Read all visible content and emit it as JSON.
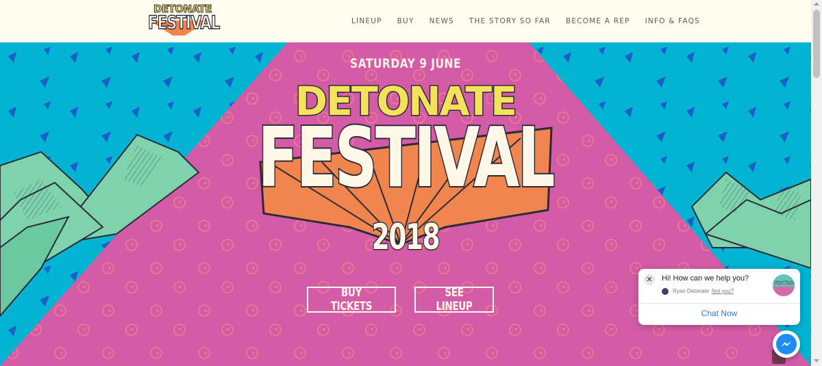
{
  "header": {
    "logo_top": "DETONATE",
    "logo_main": "FESTIVAL",
    "nav": [
      "LINEUP",
      "BUY",
      "NEWS",
      "THE STORY SO FAR",
      "BECOME A REP",
      "INFO & FAQS"
    ]
  },
  "hero": {
    "date": "SATURDAY 9 JUNE",
    "title_top": "DETONATE",
    "title_main": "FESTIVAL",
    "year": "2018",
    "buttons": {
      "tickets": "BUY TICKETS",
      "lineup": "SEE LINEUP"
    },
    "colors": {
      "sky": "#02b4d2",
      "stage": "#d45ca6",
      "mountains": "#7ed3ad",
      "title_yellow": "#f4e25a",
      "rays": "#f0864e",
      "cream": "#fff8e8"
    }
  },
  "chat": {
    "message": "Hi! How can we help you?",
    "agent_name": "Ryan Detonate",
    "not_you": "Not you?",
    "cta": "Chat Now",
    "close_icon": "close-icon",
    "messenger_icon": "messenger-icon"
  }
}
